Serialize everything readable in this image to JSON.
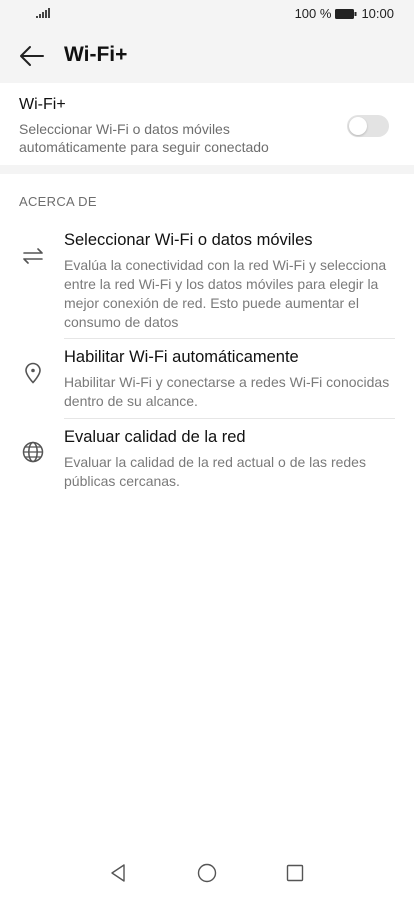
{
  "status_bar": {
    "battery_percent": "100 %",
    "time": "10:00",
    "icons": [
      "signal-icon",
      "battery-icon"
    ]
  },
  "app_bar": {
    "back_icon": "arrow-left-icon",
    "title": "Wi-Fi+"
  },
  "wifi_plus": {
    "title": "Wi-Fi+",
    "description": "Seleccionar Wi-Fi o datos móviles automáticamente para seguir conectado",
    "enabled": false
  },
  "about": {
    "header": "ACERCA DE",
    "items": [
      {
        "icon": "switch-arrows-icon",
        "title": "Seleccionar Wi-Fi o datos móviles",
        "description": "Evalúa la conectividad con la red Wi-Fi y selecciona entre la red Wi-Fi y los datos móviles para elegir la mejor conexión de red. Esto puede aumentar el consumo de datos"
      },
      {
        "icon": "location-pin-icon",
        "title": "Habilitar Wi-Fi automáticamente",
        "description": "Habilitar Wi-Fi y conectarse a redes Wi-Fi conocidas dentro de su alcance."
      },
      {
        "icon": "globe-icon",
        "title": "Evaluar calidad de la red",
        "description": "Evaluar la calidad de la red actual o de las redes públicas cercanas."
      }
    ]
  },
  "nav_bar": {
    "icons": [
      "back-triangle-icon",
      "home-circle-icon",
      "recents-square-icon"
    ]
  },
  "colors": {
    "background": "#f4f4f4",
    "surface": "#ffffff",
    "primary_text": "#111111",
    "secondary_text": "#7a7a7a",
    "switch_off": "#e3e3e3"
  }
}
